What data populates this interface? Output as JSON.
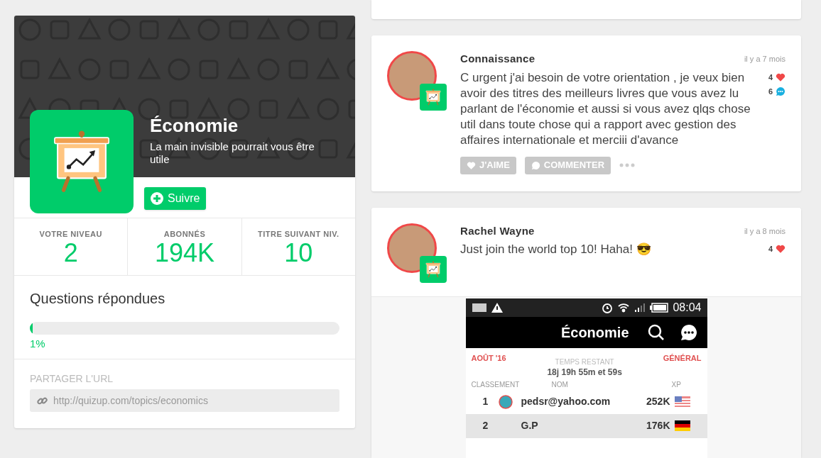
{
  "topic": {
    "title": "Économie",
    "subtitle": "La main invisible pourrait vous être utile",
    "follow_button": "Suivre"
  },
  "stats": [
    {
      "label": "VOTRE NIVEAU",
      "value": "2"
    },
    {
      "label": "ABONNÉS",
      "value": "194K"
    },
    {
      "label": "TITRE SUIVANT NIV.",
      "value": "10"
    }
  ],
  "progress": {
    "title": "Questions répondues",
    "level": 0.01,
    "reading": "1%"
  },
  "share": {
    "label": "PARTAGER L'URL",
    "url": "http://quizup.com/topics/economics"
  },
  "posts": [
    {
      "author": "Connaissance",
      "time": "il y a 7 mois",
      "text": "C urgent j'ai besoin de votre orientation , je veux bien avoir des titres des meilleurs livres que vous avez lu parlant de l'économie et aussi si vous avez qlqs chose util dans toute chose qui a rapport avec gestion des affaires internationale et merciii d'avance",
      "likes": "4",
      "comments": "6",
      "actions": [
        "J'AIME",
        "COMMENTER"
      ]
    },
    {
      "author": "Rachel Wayne",
      "time": "il y a 8 mois",
      "text": "Just join the world top 10! Haha! 😎",
      "likes": "4",
      "attachment": {
        "status_time": "08:04",
        "title": "Économie",
        "prev": "AOÛT '16",
        "next": "GÉNÉRAL",
        "remaining_label": "TEMPS RESTANT",
        "remaining": "18j 19h 55m et 59s",
        "columns": [
          "CLASSEMENT",
          "NOM",
          "XP"
        ],
        "rows": [
          {
            "rank": "1",
            "name": "pedsr@yahoo.com",
            "xp": "252K",
            "kind": "us",
            "avatar": true,
            "selected": false
          },
          {
            "rank": "2",
            "name": "G.P",
            "xp": "176K",
            "kind": "de",
            "avatar": false,
            "selected": true
          }
        ]
      }
    }
  ]
}
